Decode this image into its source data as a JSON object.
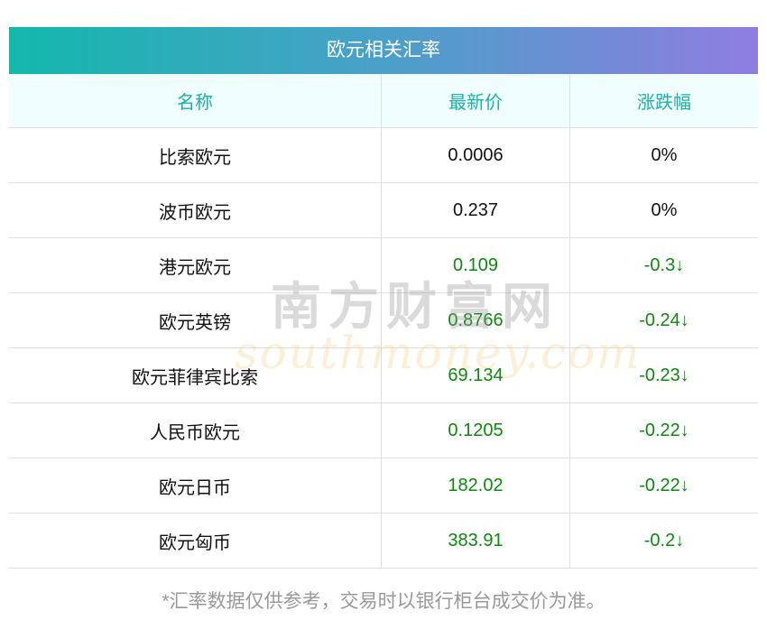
{
  "title": "欧元相关汇率",
  "columns": [
    "名称",
    "最新价",
    "涨跌幅"
  ],
  "rows": [
    {
      "name": "比索欧元",
      "price": "0.0006",
      "change": "0%",
      "trend": "flat"
    },
    {
      "name": "波币欧元",
      "price": "0.237",
      "change": "0%",
      "trend": "flat"
    },
    {
      "name": "港元欧元",
      "price": "0.109",
      "change": "-0.3↓",
      "trend": "down"
    },
    {
      "name": "欧元英镑",
      "price": "0.8766",
      "change": "-0.24↓",
      "trend": "down"
    },
    {
      "name": "欧元菲律宾比索",
      "price": "69.134",
      "change": "-0.23↓",
      "trend": "down"
    },
    {
      "name": "人民币欧元",
      "price": "0.1205",
      "change": "-0.22↓",
      "trend": "down"
    },
    {
      "name": "欧元日币",
      "price": "182.02",
      "change": "-0.22↓",
      "trend": "down"
    },
    {
      "name": "欧元匈币",
      "price": "383.91",
      "change": "-0.2↓",
      "trend": "down"
    }
  ],
  "watermark": {
    "cn": "南方财富网",
    "en": "southmoney.com"
  },
  "footnote": "*汇率数据仅供参考，交易时以银行柜台成交价为准。",
  "colors": {
    "down": "#0c8a0c",
    "header_text": "#1ab3a5"
  }
}
